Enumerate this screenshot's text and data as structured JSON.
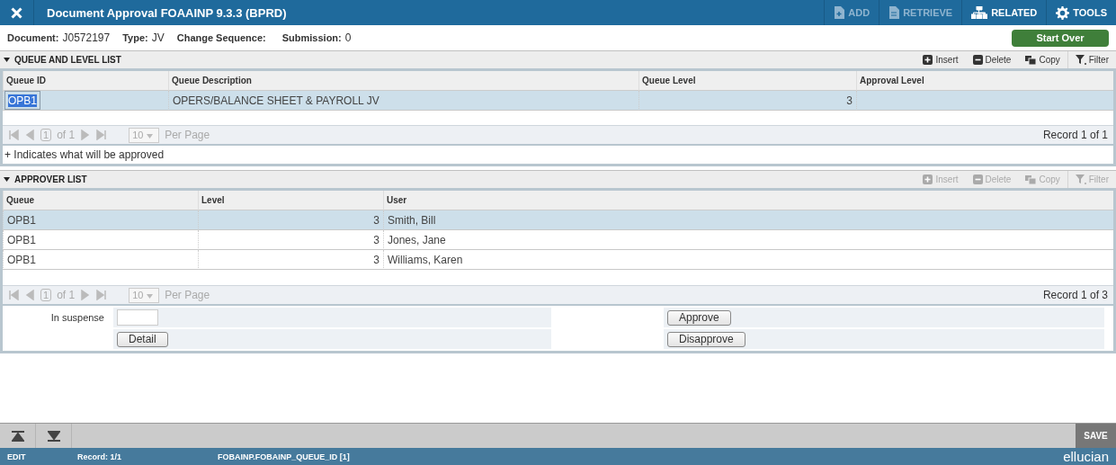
{
  "header": {
    "title": "Document Approval FOAAINP 9.3.3 (BPRD)",
    "actions": [
      {
        "kind": "add",
        "label": "ADD",
        "disabled": true
      },
      {
        "kind": "retrieve",
        "label": "RETRIEVE",
        "disabled": true
      },
      {
        "kind": "related",
        "label": "RELATED",
        "disabled": false
      },
      {
        "kind": "tools",
        "label": "TOOLS",
        "disabled": false
      }
    ]
  },
  "document": {
    "fields": [
      {
        "label": "Document:",
        "value": "J0572197"
      },
      {
        "label": "Type:",
        "value": "JV"
      },
      {
        "label": "Change Sequence:"
      },
      {
        "label": "Submission:",
        "value": "0"
      }
    ],
    "start_over": "Start Over"
  },
  "sections": [
    {
      "title": "QUEUE AND LEVEL LIST",
      "expanded": true,
      "actions": [
        {
          "kind": "insert",
          "label": "Insert",
          "disabled": false
        },
        {
          "kind": "delete",
          "label": "Delete",
          "disabled": false
        },
        {
          "kind": "copy",
          "label": "Copy",
          "disabled": false
        },
        {
          "kind": "filter",
          "label": "Filter",
          "disabled": false
        }
      ],
      "columns": [
        {
          "label": "Queue ID",
          "kind": "text"
        },
        {
          "label": "Queue Description",
          "kind": "text"
        },
        {
          "label": "Queue Level",
          "kind": "number"
        },
        {
          "label": "Approval Level",
          "kind": "text"
        }
      ],
      "rows": [
        {
          "selected": true,
          "cells": [
            "OPB1",
            "OPERS/BALANCE SHEET & PAYROLL JV",
            "3",
            ""
          ]
        }
      ],
      "pager": {
        "page": "1",
        "of": "of 1",
        "per_page": "10",
        "per_page_label": "Per Page",
        "record": "Record 1 of 1",
        "disabled": true
      },
      "note": "+ Indicates what will be approved"
    },
    {
      "title": "APPROVER LIST",
      "expanded": true,
      "actions": [
        {
          "kind": "insert",
          "label": "Insert",
          "disabled": true
        },
        {
          "kind": "delete",
          "label": "Delete",
          "disabled": true
        },
        {
          "kind": "copy",
          "label": "Copy",
          "disabled": true
        },
        {
          "kind": "filter",
          "label": "Filter",
          "disabled": true
        }
      ],
      "columns": [
        {
          "label": "Queue",
          "kind": "text"
        },
        {
          "label": "Level",
          "kind": "number"
        },
        {
          "label": "User",
          "kind": "text"
        }
      ],
      "rows": [
        {
          "selected": true,
          "cells": [
            "OPB1",
            "3",
            "Smith, Bill"
          ]
        },
        {
          "selected": false,
          "cells": [
            "OPB1",
            "3",
            "Jones, Jane"
          ]
        },
        {
          "selected": false,
          "cells": [
            "OPB1",
            "3",
            "Williams, Karen"
          ]
        }
      ],
      "pager": {
        "page": "1",
        "of": "of 1",
        "per_page": "10",
        "per_page_label": "Per Page",
        "record": "Record 1 of 3",
        "disabled": true
      }
    }
  ],
  "form": {
    "suspense_label": "In suspense",
    "detail": "Detail",
    "approve": "Approve",
    "disapprove": "Disapprove"
  },
  "footer": {
    "save": "SAVE"
  },
  "status_bar": {
    "mode": "EDIT",
    "record": "Record: 1/1",
    "field": "FOBAINP.FOBAINP_QUEUE_ID [1]",
    "brand": "ellucian"
  }
}
